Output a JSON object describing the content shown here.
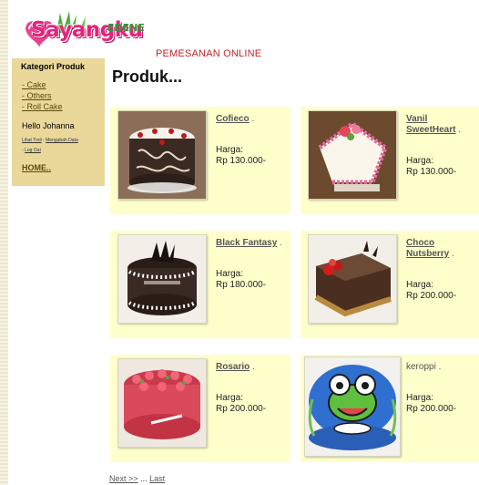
{
  "header": {
    "logo_text": "Sayangku",
    "logo_sub": "EDENE",
    "tagline": "PEMESANAN ONLINE"
  },
  "sidebar": {
    "title": "Kategori Produk",
    "categories": [
      "- Cake",
      "- Others",
      "- Roll Cake"
    ],
    "greeting": "Hello Johanna",
    "link_cart": "Lihat Troli",
    "link_change": "Mengubah Data",
    "link_logout": "Log Out",
    "home": "HOME.."
  },
  "main": {
    "title": "Produk..."
  },
  "products": [
    {
      "name": "Cofieco",
      "name_line2": "",
      "price_label": "Harga:",
      "price": "Rp 130.000-"
    },
    {
      "name": "Vanil",
      "name_line2": "SweetHeart",
      "price_label": "Harga:",
      "price": "Rp 130.000-"
    },
    {
      "name": "Black Fantasy",
      "name_line2": "",
      "price_label": "Harga:",
      "price": "Rp 180.000-"
    },
    {
      "name": "Choco",
      "name_line2": "Nutsberry",
      "price_label": "Harga:",
      "price": "Rp 200.000-"
    },
    {
      "name": "Rosario",
      "name_line2": "",
      "price_label": "Harga:",
      "price": "Rp 200.000-"
    },
    {
      "name": "keroppi",
      "name_line2": "",
      "price_label": "Harga:",
      "price": "Rp 200.000-"
    }
  ],
  "pager": {
    "next": "Next >>",
    "separator": "...",
    "last": "Last"
  },
  "colors": {
    "card_bg": "#ffffcc",
    "sidebar_bg": "#ead89a",
    "brand": "#e4237b"
  }
}
